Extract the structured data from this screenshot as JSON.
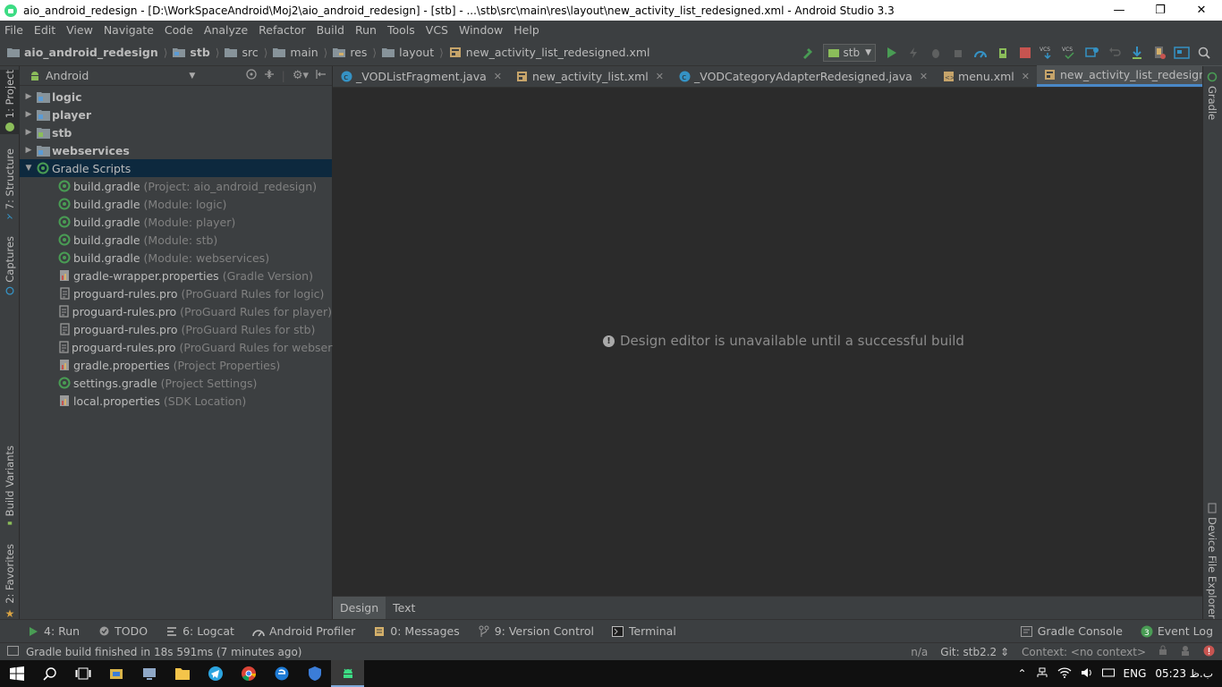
{
  "window": {
    "title": "aio_android_redesign - [D:\\WorkSpaceAndroid\\Moj2\\aio_android_redesign] - [stb] - ...\\stb\\src\\main\\res\\layout\\new_activity_list_redesigned.xml - Android Studio 3.3",
    "controls": [
      "minimize-icon",
      "restore-icon",
      "close-icon"
    ]
  },
  "menu": [
    "File",
    "Edit",
    "View",
    "Navigate",
    "Code",
    "Analyze",
    "Refactor",
    "Build",
    "Run",
    "Tools",
    "VCS",
    "Window",
    "Help"
  ],
  "breadcrumbs": [
    "aio_android_redesign",
    "stb",
    "src",
    "main",
    "res",
    "layout",
    "new_activity_list_redesigned.xml"
  ],
  "toolbar": {
    "run_config": "stb",
    "vcs_label": "VCS"
  },
  "left_tabs": [
    "1: Project",
    "7: Structure",
    "Captures",
    "Build Variants",
    "2: Favorites"
  ],
  "right_tabs": [
    "Gradle",
    "Device File Explorer"
  ],
  "project": {
    "view": "Android",
    "items": [
      {
        "name": "logic",
        "hint": "",
        "type": "module",
        "expanded": false
      },
      {
        "name": "player",
        "hint": "",
        "type": "module",
        "expanded": false
      },
      {
        "name": "stb",
        "hint": "",
        "type": "module",
        "expanded": false
      },
      {
        "name": "webservices",
        "hint": "",
        "type": "module",
        "expanded": false
      },
      {
        "name": "Gradle Scripts",
        "hint": "",
        "type": "gradle-root",
        "expanded": true
      },
      {
        "name": "build.gradle",
        "hint": "(Project: aio_android_redesign)",
        "type": "gradle"
      },
      {
        "name": "build.gradle",
        "hint": "(Module: logic)",
        "type": "gradle"
      },
      {
        "name": "build.gradle",
        "hint": "(Module: player)",
        "type": "gradle"
      },
      {
        "name": "build.gradle",
        "hint": "(Module: stb)",
        "type": "gradle"
      },
      {
        "name": "build.gradle",
        "hint": "(Module: webservices)",
        "type": "gradle"
      },
      {
        "name": "gradle-wrapper.properties",
        "hint": "(Gradle Version)",
        "type": "properties"
      },
      {
        "name": "proguard-rules.pro",
        "hint": "(ProGuard Rules for logic)",
        "type": "text"
      },
      {
        "name": "proguard-rules.pro",
        "hint": "(ProGuard Rules for player)",
        "type": "text"
      },
      {
        "name": "proguard-rules.pro",
        "hint": "(ProGuard Rules for stb)",
        "type": "text"
      },
      {
        "name": "proguard-rules.pro",
        "hint": "(ProGuard Rules for webservices)",
        "type": "text"
      },
      {
        "name": "gradle.properties",
        "hint": "(Project Properties)",
        "type": "properties"
      },
      {
        "name": "settings.gradle",
        "hint": "(Project Settings)",
        "type": "gradle"
      },
      {
        "name": "local.properties",
        "hint": "(SDK Location)",
        "type": "properties"
      }
    ]
  },
  "editor_tabs": [
    {
      "label": "_VODListFragment.java",
      "type": "class",
      "active": false
    },
    {
      "label": "new_activity_list.xml",
      "type": "layout",
      "active": false
    },
    {
      "label": "_VODCategoryAdapterRedesigned.java",
      "type": "class",
      "active": false
    },
    {
      "label": "menu.xml",
      "type": "xml",
      "active": false
    },
    {
      "label": "new_activity_list_redesigned.xml",
      "type": "layout",
      "active": true
    }
  ],
  "editor": {
    "message": "Design editor is unavailable until a successful build",
    "design_tab": "Design",
    "text_tab": "Text"
  },
  "bottom_tools": {
    "left": [
      {
        "label": "4: Run",
        "icon": "run-icon"
      },
      {
        "label": "TODO",
        "icon": "todo-icon"
      },
      {
        "label": "6: Logcat",
        "icon": "logcat-icon"
      },
      {
        "label": "Android Profiler",
        "icon": "profiler-icon"
      },
      {
        "label": "0: Messages",
        "icon": "messages-icon"
      },
      {
        "label": "9: Version Control",
        "icon": "version-control-icon"
      },
      {
        "label": "Terminal",
        "icon": "terminal-icon"
      }
    ],
    "right": [
      {
        "label": "Gradle Console",
        "icon": "gradle-console-icon"
      },
      {
        "label": "Event Log",
        "icon": "event-log-icon",
        "badge": "3"
      }
    ]
  },
  "status": {
    "message": "Gradle build finished in 18s 591ms (7 minutes ago)",
    "position": "n/a",
    "git": "Git: stb2.2 ⇕",
    "context": "Context: <no context>"
  },
  "taskbar": {
    "lang": "ENG",
    "time": "05:23 ب.ظ"
  },
  "colors": {
    "panel": "#3c3f41",
    "editor_bg": "#2b2b2b",
    "selection": "#0d293e",
    "accent": "#4a88c7",
    "run_green": "#499c54",
    "stop_red": "#c75450"
  }
}
